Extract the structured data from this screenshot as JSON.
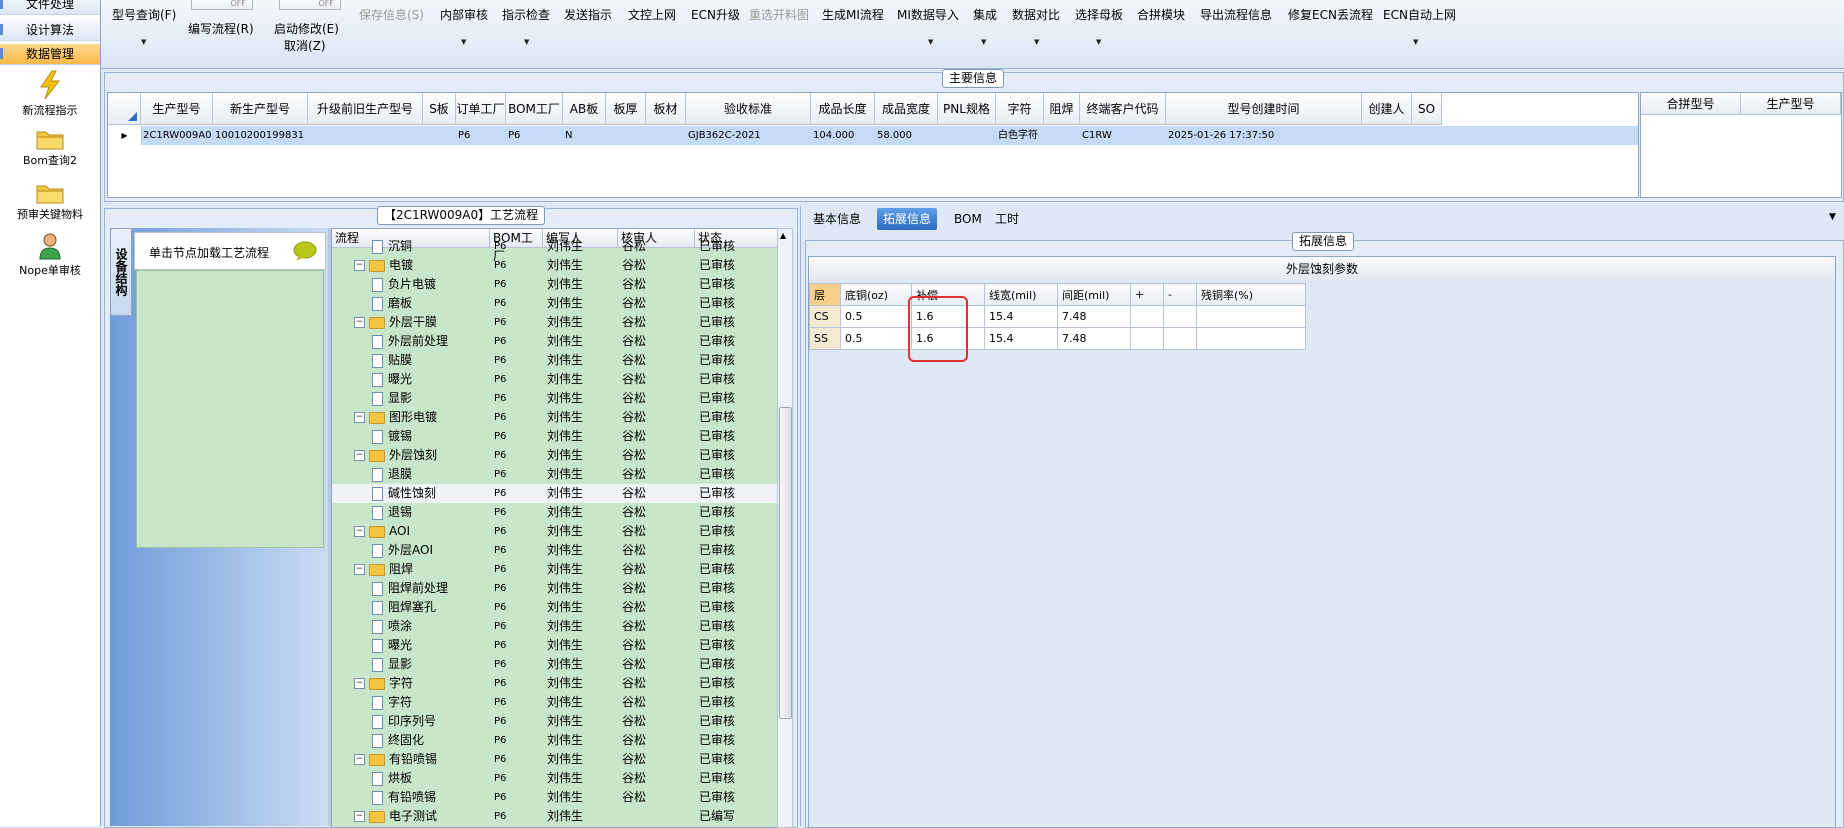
{
  "nav": {
    "top_items": [
      "文件处理",
      "设计算法",
      "数据管理"
    ],
    "icon_items": [
      {
        "label": "新流程指示",
        "icon": "lightning-icon"
      },
      {
        "label": "Bom查询2",
        "icon": "folder-icon"
      },
      {
        "label": "预审关键物料",
        "icon": "folder-icon"
      },
      {
        "label": "Nope单审核",
        "icon": "user-icon"
      }
    ]
  },
  "toolbar": {
    "items": [
      "型号查询(F)",
      "编写流程(R)",
      "启动修改(E)",
      "取消(Z)",
      "保存信息(S)",
      "内部审核",
      "指示检查",
      "发送指示",
      "文控上网",
      "ECN升级",
      "重选开料图",
      "生成MI流程",
      "MI数据导入",
      "集成",
      "数据对比",
      "选择母板",
      "合拼模块",
      "导出流程信息",
      "修复ECN丢流程",
      "ECN自动上网"
    ],
    "switch_label": "OFF"
  },
  "main_info": {
    "title": "主要信息",
    "columns": [
      "生产型号",
      "新生产型号",
      "升级前旧生产型号",
      "S板",
      "订单工厂",
      "BOM工厂",
      "AB板",
      "板厚",
      "板材",
      "验收标准",
      "成品长度",
      "成品宽度",
      "PNL规格",
      "字符",
      "阻焊",
      "终端客户代码",
      "型号创建时间",
      "创建人",
      "SO"
    ],
    "row": [
      "2C1RW009A0",
      "10010200199831",
      "",
      "",
      "P6",
      "P6",
      "N",
      "",
      "",
      "GJB362C-2021",
      "104.000",
      "58.000",
      "",
      "白色字符",
      "",
      "C1RW",
      "2025-01-26 17:37:50",
      "",
      ""
    ],
    "side_columns": [
      "合拼型号",
      "生产型号"
    ]
  },
  "process": {
    "title": "【2C1RW009A0】工艺流程",
    "side_tab": "设备结构",
    "hint": "单击节点加载工艺流程",
    "columns": [
      "流程",
      "BOM工厂",
      "编写人",
      "核审人",
      "状态"
    ],
    "rows": [
      {
        "level": 2,
        "type": "doc",
        "name": "沉铜",
        "bom": "P6",
        "writer": "刘伟生",
        "reviewer": "谷松",
        "status": "已审核"
      },
      {
        "level": 1,
        "type": "folder",
        "name": "电镀",
        "bom": "P6",
        "writer": "刘伟生",
        "reviewer": "谷松",
        "status": "已审核"
      },
      {
        "level": 2,
        "type": "doc",
        "name": "负片电镀",
        "bom": "P6",
        "writer": "刘伟生",
        "reviewer": "谷松",
        "status": "已审核"
      },
      {
        "level": 2,
        "type": "doc",
        "name": "磨板",
        "bom": "P6",
        "writer": "刘伟生",
        "reviewer": "谷松",
        "status": "已审核"
      },
      {
        "level": 1,
        "type": "folder",
        "name": "外层干膜",
        "bom": "P6",
        "writer": "刘伟生",
        "reviewer": "谷松",
        "status": "已审核"
      },
      {
        "level": 2,
        "type": "doc",
        "name": "外层前处理",
        "bom": "P6",
        "writer": "刘伟生",
        "reviewer": "谷松",
        "status": "已审核"
      },
      {
        "level": 2,
        "type": "doc",
        "name": "贴膜",
        "bom": "P6",
        "writer": "刘伟生",
        "reviewer": "谷松",
        "status": "已审核"
      },
      {
        "level": 2,
        "type": "doc",
        "name": "曝光",
        "bom": "P6",
        "writer": "刘伟生",
        "reviewer": "谷松",
        "status": "已审核"
      },
      {
        "level": 2,
        "type": "doc",
        "name": "显影",
        "bom": "P6",
        "writer": "刘伟生",
        "reviewer": "谷松",
        "status": "已审核"
      },
      {
        "level": 1,
        "type": "folder",
        "name": "图形电镀",
        "bom": "P6",
        "writer": "刘伟生",
        "reviewer": "谷松",
        "status": "已审核"
      },
      {
        "level": 2,
        "type": "doc",
        "name": "镀锡",
        "bom": "P6",
        "writer": "刘伟生",
        "reviewer": "谷松",
        "status": "已审核"
      },
      {
        "level": 1,
        "type": "folder",
        "name": "外层蚀刻",
        "bom": "P6",
        "writer": "刘伟生",
        "reviewer": "谷松",
        "status": "已审核"
      },
      {
        "level": 2,
        "type": "doc",
        "name": "退膜",
        "bom": "P6",
        "writer": "刘伟生",
        "reviewer": "谷松",
        "status": "已审核"
      },
      {
        "level": 2,
        "type": "doc",
        "name": "碱性蚀刻",
        "bom": "P6",
        "writer": "刘伟生",
        "reviewer": "谷松",
        "status": "已审核",
        "selected": true
      },
      {
        "level": 2,
        "type": "doc",
        "name": "退锡",
        "bom": "P6",
        "writer": "刘伟生",
        "reviewer": "谷松",
        "status": "已审核"
      },
      {
        "level": 1,
        "type": "folder",
        "name": "AOI",
        "bom": "P6",
        "writer": "刘伟生",
        "reviewer": "谷松",
        "status": "已审核"
      },
      {
        "level": 2,
        "type": "doc",
        "name": "外层AOI",
        "bom": "P6",
        "writer": "刘伟生",
        "reviewer": "谷松",
        "status": "已审核"
      },
      {
        "level": 1,
        "type": "folder",
        "name": "阻焊",
        "bom": "P6",
        "writer": "刘伟生",
        "reviewer": "谷松",
        "status": "已审核"
      },
      {
        "level": 2,
        "type": "doc",
        "name": "阻焊前处理",
        "bom": "P6",
        "writer": "刘伟生",
        "reviewer": "谷松",
        "status": "已审核"
      },
      {
        "level": 2,
        "type": "doc",
        "name": "阻焊塞孔",
        "bom": "P6",
        "writer": "刘伟生",
        "reviewer": "谷松",
        "status": "已审核"
      },
      {
        "level": 2,
        "type": "doc",
        "name": "喷涂",
        "bom": "P6",
        "writer": "刘伟生",
        "reviewer": "谷松",
        "status": "已审核"
      },
      {
        "level": 2,
        "type": "doc",
        "name": "曝光",
        "bom": "P6",
        "writer": "刘伟生",
        "reviewer": "谷松",
        "status": "已审核"
      },
      {
        "level": 2,
        "type": "doc",
        "name": "显影",
        "bom": "P6",
        "writer": "刘伟生",
        "reviewer": "谷松",
        "status": "已审核"
      },
      {
        "level": 1,
        "type": "folder",
        "name": "字符",
        "bom": "P6",
        "writer": "刘伟生",
        "reviewer": "谷松",
        "status": "已审核"
      },
      {
        "level": 2,
        "type": "doc",
        "name": "字符",
        "bom": "P6",
        "writer": "刘伟生",
        "reviewer": "谷松",
        "status": "已审核"
      },
      {
        "level": 2,
        "type": "doc",
        "name": "印序列号",
        "bom": "P6",
        "writer": "刘伟生",
        "reviewer": "谷松",
        "status": "已审核"
      },
      {
        "level": 2,
        "type": "doc",
        "name": "终固化",
        "bom": "P6",
        "writer": "刘伟生",
        "reviewer": "谷松",
        "status": "已审核"
      },
      {
        "level": 1,
        "type": "folder",
        "name": "有铅喷锡",
        "bom": "P6",
        "writer": "刘伟生",
        "reviewer": "谷松",
        "status": "已审核"
      },
      {
        "level": 2,
        "type": "doc",
        "name": "烘板",
        "bom": "P6",
        "writer": "刘伟生",
        "reviewer": "谷松",
        "status": "已审核"
      },
      {
        "level": 2,
        "type": "doc",
        "name": "有铅喷锡",
        "bom": "P6",
        "writer": "刘伟生",
        "reviewer": "谷松",
        "status": "已审核"
      },
      {
        "level": 1,
        "type": "folder",
        "name": "电子测试",
        "bom": "P6",
        "writer": "刘伟生",
        "reviewer": "",
        "status": "已编写"
      }
    ]
  },
  "right": {
    "tabs": [
      "基本信息",
      "拓展信息",
      "BOM",
      "工时"
    ],
    "active_tab": 1,
    "group_title": "拓展信息",
    "grid_title": "外层蚀刻参数",
    "grid_columns": [
      "层",
      "底铜(oz)",
      "补偿",
      "线宽(mil)",
      "间距(mil)",
      "+",
      "-",
      "残铜率(%)"
    ],
    "grid_rows": [
      [
        "CS",
        "0.5",
        "1.6",
        "15.4",
        "7.48",
        "",
        "",
        ""
      ],
      [
        "SS",
        "0.5",
        "1.6",
        "15.4",
        "7.48",
        "",
        "",
        ""
      ]
    ]
  },
  "colors": {
    "accent_blue": "#2c6cc4",
    "tree_bg": "#c8e6c9",
    "highlight_red": "#e03030",
    "selected_row": "#c4daf5"
  }
}
